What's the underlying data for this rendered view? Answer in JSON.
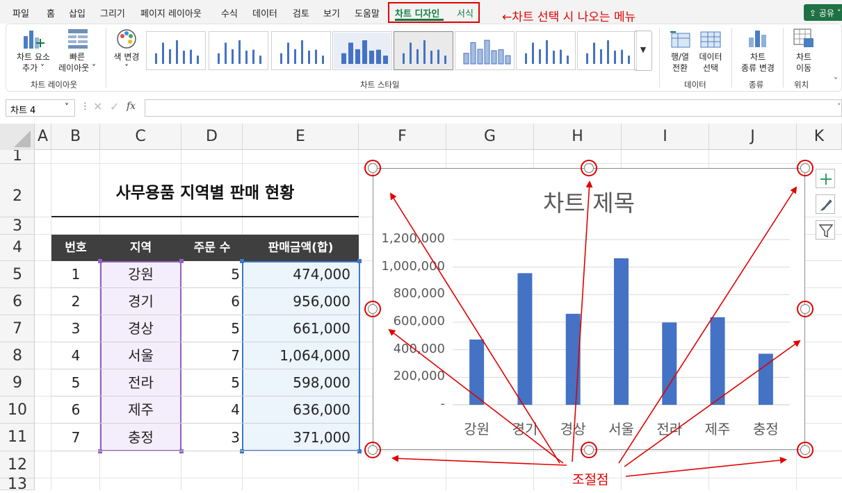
{
  "menu": {
    "items": [
      "파일",
      "홈",
      "삽입",
      "그리기",
      "페이지 레이아웃",
      "수식",
      "데이터",
      "검토",
      "보기",
      "도움말",
      "차트 디자인",
      "서식"
    ],
    "share_label": "공유"
  },
  "annotation": {
    "menu_note": "←차트 선택 시 나오는 메뉴",
    "handles_note": "조절점"
  },
  "ribbon": {
    "add_element": [
      "차트 요소",
      "추가"
    ],
    "quick_layout": [
      "빠른",
      "레이아웃"
    ],
    "change_color": "색 변경",
    "switch_row_col": [
      "행/열",
      "전환"
    ],
    "select_data": [
      "데이터",
      "선택"
    ],
    "change_type": [
      "차트",
      "종류 변경"
    ],
    "move_chart": [
      "차트",
      "이동"
    ],
    "groups": {
      "layouts": "차트 레이아웃",
      "styles": "차트 스타일",
      "data": "데이터",
      "type": "종류",
      "location": "위치"
    }
  },
  "formula_bar": {
    "name_box": "차트 4",
    "fx": "fx",
    "value": ""
  },
  "grid": {
    "columns": [
      "A",
      "B",
      "C",
      "D",
      "E",
      "F",
      "G",
      "H",
      "I",
      "J",
      "K"
    ],
    "rows": [
      "1",
      "2",
      "3",
      "4",
      "5",
      "6",
      "7",
      "8",
      "9",
      "10",
      "11",
      "12",
      "13"
    ]
  },
  "sheet": {
    "title": "사무용품 지역별 판매 현황",
    "headers": [
      "번호",
      "지역",
      "주문 수",
      "판매금액(합)"
    ],
    "rows": [
      {
        "no": "1",
        "region": "강원",
        "orders": "5",
        "amount": "474,000"
      },
      {
        "no": "2",
        "region": "경기",
        "orders": "6",
        "amount": "956,000"
      },
      {
        "no": "3",
        "region": "경상",
        "orders": "5",
        "amount": "661,000"
      },
      {
        "no": "4",
        "region": "서울",
        "orders": "7",
        "amount": "1,064,000"
      },
      {
        "no": "5",
        "region": "전라",
        "orders": "5",
        "amount": "598,000"
      },
      {
        "no": "6",
        "region": "제주",
        "orders": "4",
        "amount": "636,000"
      },
      {
        "no": "7",
        "region": "충정",
        "orders": "3",
        "amount": "371,000"
      }
    ]
  },
  "chart_data": {
    "type": "bar",
    "title": "차트 제목",
    "categories": [
      "강원",
      "경기",
      "경상",
      "서울",
      "전라",
      "제주",
      "충정"
    ],
    "values": [
      474000,
      956000,
      661000,
      1064000,
      598000,
      636000,
      371000
    ],
    "ylim": [
      0,
      1200000
    ],
    "yticks": [
      "-",
      "200,000",
      "400,000",
      "600,000",
      "800,000",
      "1,000,000",
      "1,200,000"
    ],
    "grid": true,
    "color": "#4472c4"
  },
  "colors": {
    "accent": "#107c41",
    "annotation": "#e00000",
    "bar": "#4472c4",
    "header_bg": "#3f3f3f"
  }
}
